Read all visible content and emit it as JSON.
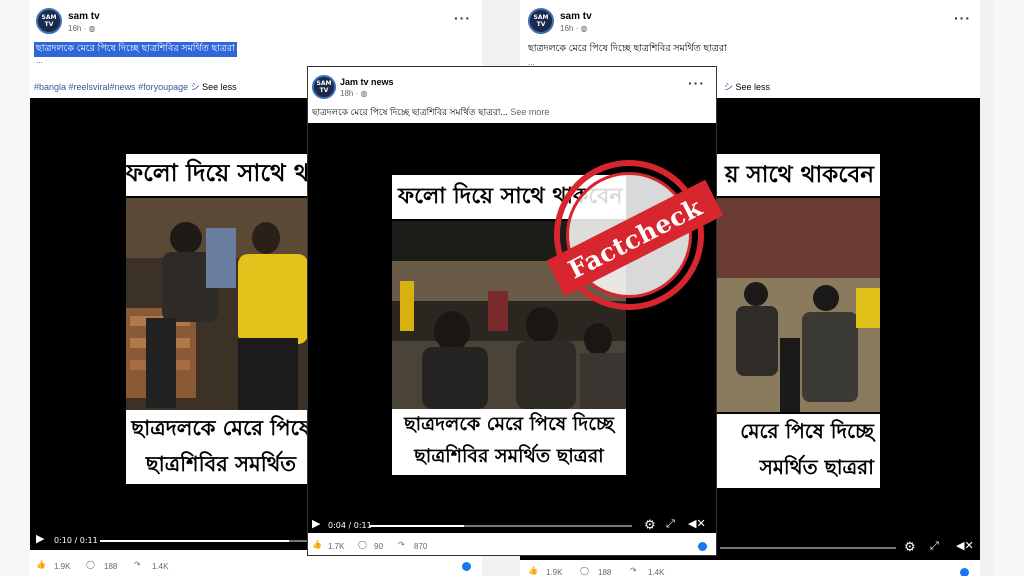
{
  "posts": {
    "left": {
      "page_name": "sam tv",
      "time": "16h · ",
      "caption": "ছাত্রদলকে মেরে পিষে দিচ্ছে ছাত্রশিবির সমর্থিত ছাত্ররা",
      "dots_line": "...",
      "tags": "#bangla #reelsviral#news #foryoupage",
      "see_less": "See less",
      "banner_top": "ফলো দিয়ে সাথে থা",
      "banner_bottom_1": "ছাত্রদলকে মেরে পিষে",
      "banner_bottom_2": "ছাত্রশিবির সমর্থিত",
      "time_code": "0:10 / 0:11",
      "progress": 0.91,
      "likes": "1.9K",
      "comments": "188",
      "shares": "1.4K"
    },
    "right": {
      "page_name": "sam tv",
      "time": "16h · ",
      "caption": "ছাত্রদলকে মেরে পিষে দিচ্ছে ছাত্রশিবির সমর্থিত ছাত্ররা",
      "dots_line": "...",
      "see_less": "See less",
      "banner_top": "য় সাথে থাকবেন",
      "banner_bottom_1": "মেরে পিষে দিচ্ছে",
      "banner_bottom_2": "সমর্থিত ছাত্ররা",
      "likes": "1.9K",
      "comments": "188",
      "shares": "1.4K"
    },
    "center": {
      "page_name": "Jam tv news",
      "time": "18h · ",
      "caption": "ছাত্রদলকে মেরে পিষে দিচ্ছে ছাত্রশিবির সমর্থিত ছাত্ররা...",
      "see_more": "See more",
      "banner_top": "ফলো দিয়ে সাথে থাকবেন",
      "banner_bottom_1": "ছাত্রদলকে মেরে পিষে দিচ্ছে",
      "banner_bottom_2": "ছাত্রশিবির সমর্থিত ছাত্ররা",
      "time_code": "0:04 / 0:11",
      "progress": 0.36,
      "likes": "1.7K",
      "comments": "90",
      "shares": "870"
    }
  },
  "avatar_text": "SAM TV",
  "stamp_text": "Factcheck",
  "colors": {
    "stamp": "#d7262e",
    "link": "#385898",
    "highlight": "#2f66d9"
  },
  "icons": [
    "play-icon",
    "settings-icon",
    "fullscreen-icon",
    "volume-icon",
    "like-icon",
    "comment-icon",
    "share-icon",
    "more-icon",
    "globe-icon"
  ]
}
